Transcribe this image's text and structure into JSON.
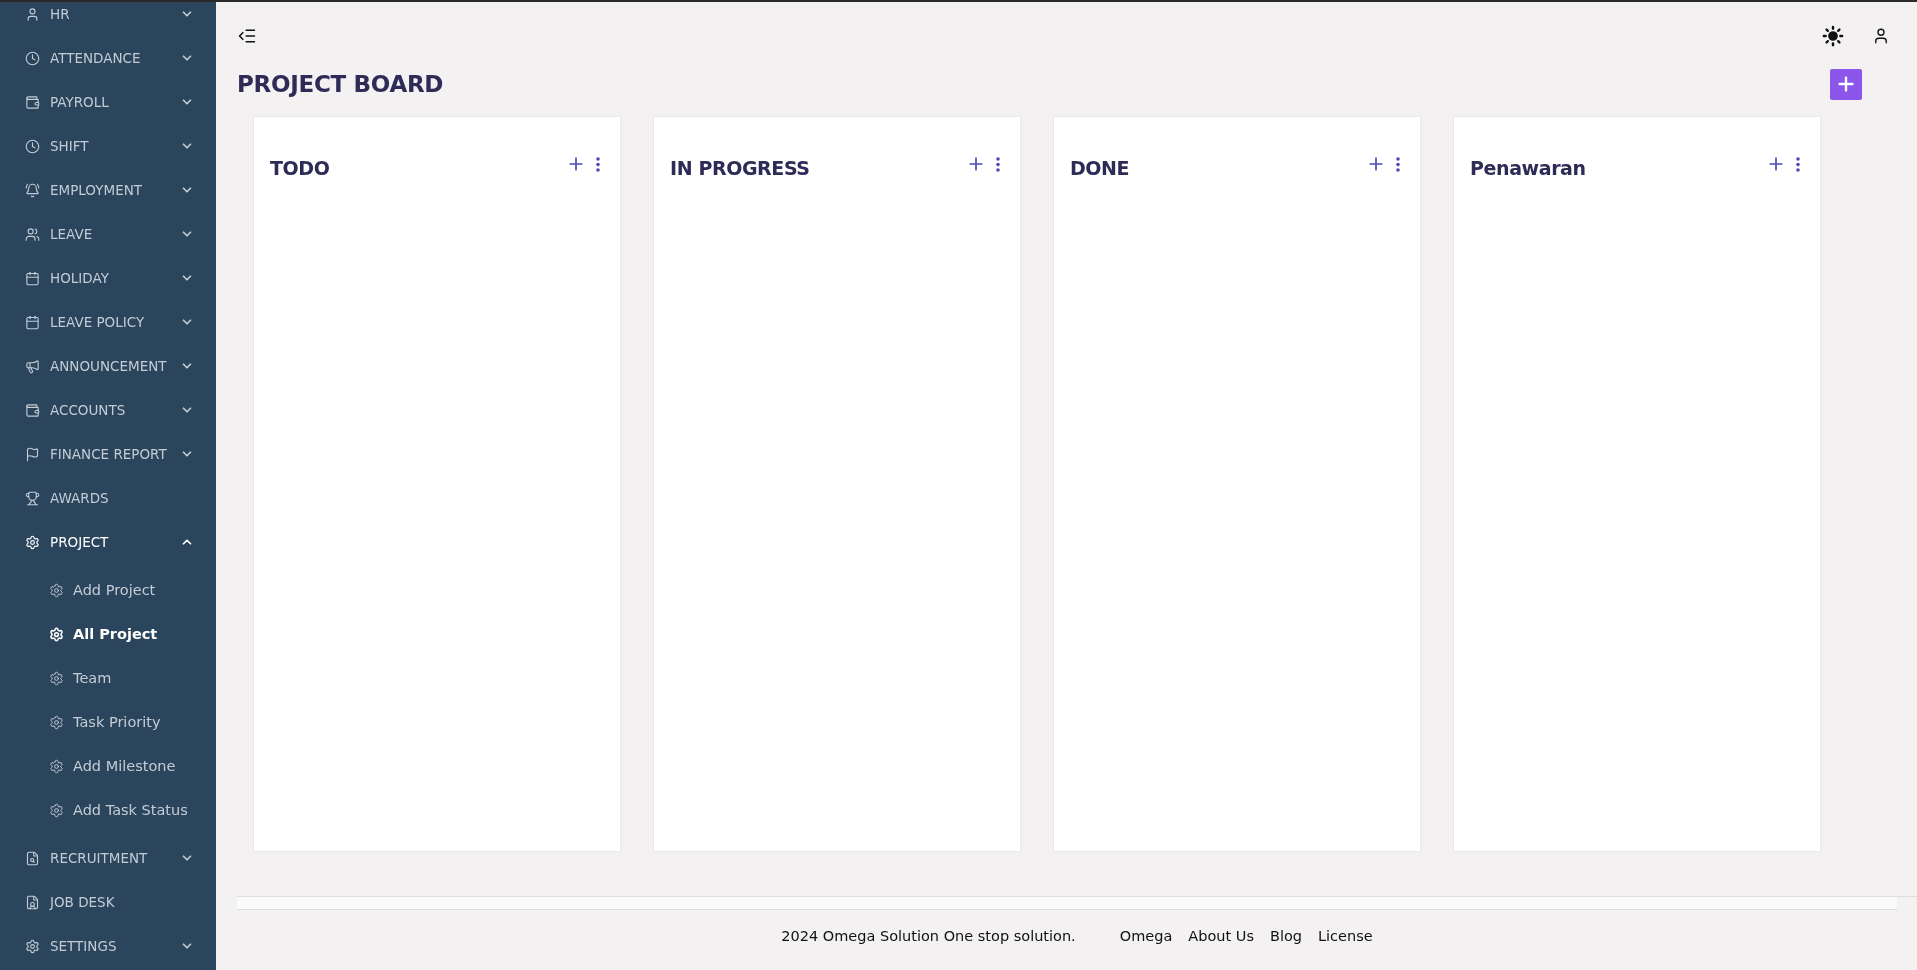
{
  "sidebar": {
    "items": [
      {
        "label": "HR",
        "kind": "group",
        "expanded": false
      },
      {
        "label": "ATTENDANCE",
        "kind": "group",
        "expanded": false
      },
      {
        "label": "PAYROLL",
        "kind": "group",
        "expanded": false
      },
      {
        "label": "SHIFT",
        "kind": "group",
        "expanded": false
      },
      {
        "label": "EMPLOYMENT",
        "kind": "group",
        "expanded": false
      },
      {
        "label": "LEAVE",
        "kind": "group",
        "expanded": false
      },
      {
        "label": "HOLIDAY",
        "kind": "group",
        "expanded": false
      },
      {
        "label": "LEAVE POLICY",
        "kind": "group",
        "expanded": false
      },
      {
        "label": "ANNOUNCEMENT",
        "kind": "group",
        "expanded": false
      },
      {
        "label": "ACCOUNTS",
        "kind": "group",
        "expanded": false
      },
      {
        "label": "FINANCE REPORT",
        "kind": "group",
        "expanded": false
      },
      {
        "label": "AWARDS",
        "kind": "link"
      },
      {
        "label": "PROJECT",
        "kind": "group",
        "expanded": true,
        "children": [
          {
            "label": "Add Project",
            "selected": false
          },
          {
            "label": "All Project",
            "selected": true
          },
          {
            "label": "Team",
            "selected": false
          },
          {
            "label": "Task Priority",
            "selected": false
          },
          {
            "label": "Add Milestone",
            "selected": false
          },
          {
            "label": "Add Task Status",
            "selected": false
          }
        ]
      },
      {
        "label": "RECRUITMENT",
        "kind": "group",
        "expanded": false
      },
      {
        "label": "JOB DESK",
        "kind": "link"
      },
      {
        "label": "SETTINGS",
        "kind": "group",
        "expanded": false
      }
    ]
  },
  "page": {
    "title": "PROJECT BOARD"
  },
  "board": {
    "columns": [
      {
        "title": "TODO"
      },
      {
        "title": "IN PROGRESS"
      },
      {
        "title": "DONE"
      },
      {
        "title": "Penawaran"
      }
    ]
  },
  "footer": {
    "copyright": "2024 Omega Solution One stop solution.",
    "links": [
      "Omega",
      "About Us",
      "Blog",
      "License"
    ]
  }
}
